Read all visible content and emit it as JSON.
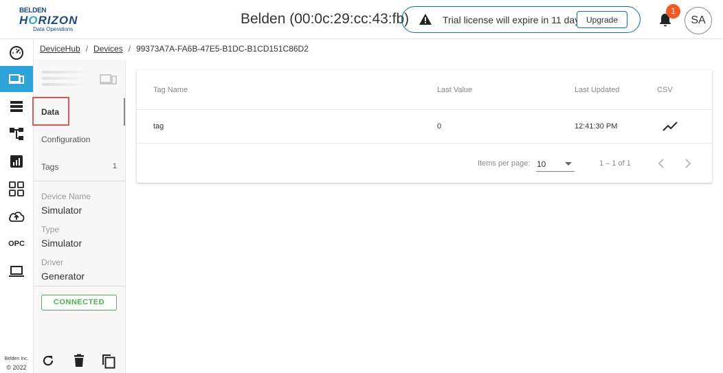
{
  "brand": {
    "line1": "BELDEN",
    "line2_a": "H",
    "line2_o": "O",
    "line2_b": "RIZON",
    "line3": "Data Operations"
  },
  "header": {
    "device_title": "Belden (00:0c:29:cc:43:fb)",
    "trial_message": "Trial license will expire in 11 days",
    "upgrade_label": "Upgrade",
    "notification_count": "1",
    "avatar_initials": "SA"
  },
  "rail": {
    "items": [
      "dashboard-icon",
      "devices-icon",
      "list-icon",
      "hierarchy-icon",
      "report-icon",
      "apps-icon",
      "cloud-upload-icon",
      "OPC",
      "laptop-icon"
    ],
    "active_index": 1,
    "accent": "#2da3d9",
    "opc_label": "OPC",
    "copyright_line1": "Belden Inc.",
    "copyright_line2": "© 2022"
  },
  "breadcrumb": {
    "items": [
      "DeviceHub",
      "Devices",
      "99373A7A-FA6B-47E5-B1DC-B1CD151C86D2"
    ]
  },
  "panel": {
    "nav": [
      {
        "label": "Data",
        "count": ""
      },
      {
        "label": "Configuration",
        "count": ""
      },
      {
        "label": "Tags",
        "count": "1"
      }
    ],
    "device_name_label": "Device Name",
    "device_name_value": "Simulator",
    "type_label": "Type",
    "type_value": "Simulator",
    "driver_label": "Driver",
    "driver_value": "Generator",
    "status": "CONNECTED",
    "status_color": "#4caf50"
  },
  "table": {
    "columns": [
      "Tag Name",
      "Last Value",
      "Last Updated",
      "CSV"
    ],
    "rows": [
      {
        "tag_name": "tag",
        "last_value": "0",
        "last_updated": "12:41:30 PM",
        "csv_icon": "trend-icon"
      }
    ],
    "items_per_page_label": "Items per page:",
    "items_per_page_value": "10",
    "range_label": "1 – 1 of 1"
  }
}
